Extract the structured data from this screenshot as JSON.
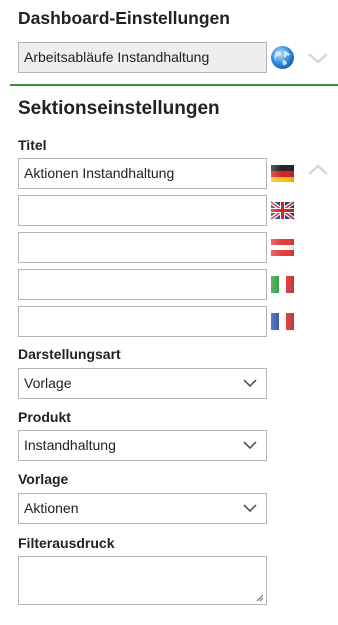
{
  "header": {
    "title": "Dashboard-Einstellungen"
  },
  "dashboard": {
    "selected_value": "Arbeitsabläufe Instandhaltung"
  },
  "section": {
    "title": "Sektionseinstellungen"
  },
  "title_field": {
    "label": "Titel",
    "translations": [
      {
        "lang": "de",
        "icon": "flag-germany-icon",
        "value": "Aktionen Instandhaltung"
      },
      {
        "lang": "en",
        "icon": "flag-uk-icon",
        "value": ""
      },
      {
        "lang": "at",
        "icon": "flag-austria-icon",
        "value": ""
      },
      {
        "lang": "it",
        "icon": "flag-italy-icon",
        "value": ""
      },
      {
        "lang": "fr",
        "icon": "flag-france-icon",
        "value": ""
      }
    ]
  },
  "display_type": {
    "label": "Darstellungsart",
    "value": "Vorlage"
  },
  "product": {
    "label": "Produkt",
    "value": "Instandhaltung"
  },
  "template": {
    "label": "Vorlage",
    "value": "Aktionen"
  },
  "filter": {
    "label": "Filterausdruck",
    "value": ""
  },
  "colors": {
    "divider": "#3a8a3a",
    "field_border": "#b5b5b5",
    "disabled_field_bg": "#eeeeee"
  }
}
